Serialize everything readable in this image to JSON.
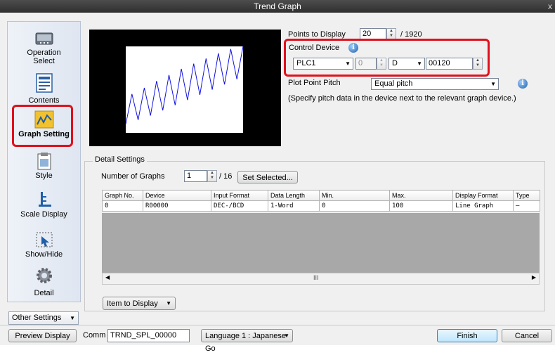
{
  "window": {
    "title": "Trend Graph",
    "close_glyph": "x"
  },
  "sidebar": {
    "items": [
      {
        "label_1": "Operation",
        "label_2": "Select",
        "icon": "operation-select-icon"
      },
      {
        "label": "Contents",
        "icon": "contents-icon"
      },
      {
        "label": "Graph Setting",
        "icon": "graph-setting-icon",
        "selected": true
      },
      {
        "label": "Style",
        "icon": "style-icon"
      },
      {
        "label": "Scale Display",
        "icon": "scale-display-icon"
      },
      {
        "label": "Show/Hide",
        "icon": "show-hide-icon"
      },
      {
        "label": "Detail",
        "icon": "gear-icon"
      }
    ],
    "other_settings": "Other Settings"
  },
  "settings": {
    "points_label": "Points to Display",
    "points_value": "20",
    "points_max": "/ 1920",
    "control_device_label": "Control Device",
    "device_plc": "PLC1",
    "device_station": "0",
    "device_type": "D",
    "device_address": "00120",
    "plot_pitch_label": "Plot Point Pitch",
    "plot_pitch_value": "Equal pitch",
    "pitch_note": "(Specify pitch data in the device next to the relevant graph device.)"
  },
  "detail": {
    "title": "Detail Settings",
    "num_graphs_label": "Number of Graphs",
    "num_graphs_value": "1",
    "num_graphs_max": "/ 16",
    "set_selected": "Set Selected...",
    "columns": [
      "Graph No.",
      "Device",
      "Input Format",
      "Data Length",
      "Min.",
      "Max.",
      "Display Format",
      "Type"
    ],
    "rows": [
      [
        "0",
        "R00000",
        "DEC-/BCD",
        "1-Word",
        "0",
        "100",
        "Line Graph",
        "—"
      ]
    ],
    "scroll_center": "III",
    "item_to_display": "Item to Display"
  },
  "footer": {
    "preview_display": "Preview Display",
    "comm_label": "Comm",
    "comm_value": "TRND_SPL_00000",
    "language": "Language 1 : Japanese Go",
    "finish": "Finish",
    "cancel": "Cancel"
  },
  "chart_data": {
    "type": "line",
    "title": "",
    "xlabel": "",
    "ylabel": "",
    "x": [
      0,
      1,
      2,
      3,
      4,
      5,
      6,
      7,
      8,
      9,
      10,
      11,
      12,
      13,
      14,
      15,
      16,
      17,
      18,
      19
    ],
    "series": [
      {
        "values": [
          10,
          45,
          15,
          52,
          20,
          60,
          26,
          67,
          32,
          74,
          38,
          80,
          44,
          86,
          50,
          92,
          56,
          97,
          62,
          100
        ]
      }
    ],
    "ylim": [
      0,
      100
    ],
    "colors": {
      "line": "#1010e0",
      "background": "#ffffff",
      "panel": "#000000",
      "highlight": "#e0101c"
    }
  }
}
